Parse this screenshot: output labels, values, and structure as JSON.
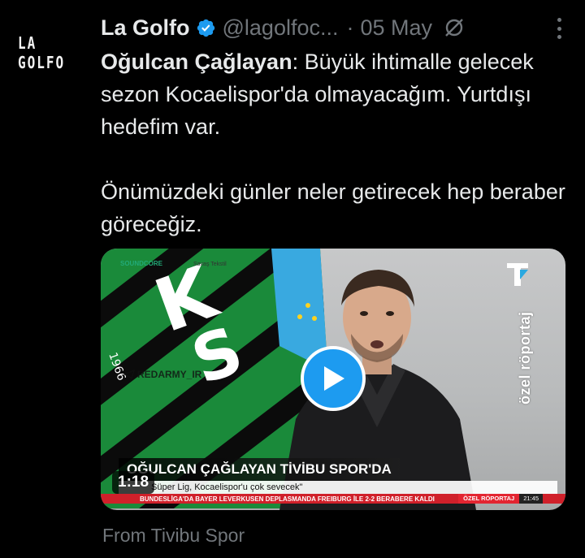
{
  "avatar": {
    "text": "LA GOLFO"
  },
  "tweet": {
    "author_name": "La Golfo",
    "handle": "@lagolfoc...",
    "separator": "·",
    "date": "05 May",
    "text_bold": "Oğulcan Çağlayan",
    "text_rest": ": Büyük ihtimalle gelecek sezon Kocaelispor'da olmayacağım. Yurtdışı hedefim var.\n\nÖnümüzdeki günler neler getirecek hep beraber göreceğiz.",
    "source": "From Tivibu Spor"
  },
  "video": {
    "duration": "1:18",
    "lower_title": "OĞULCAN ÇAĞLAYAN TİVİBU SPOR'DA",
    "lower_sub": "Süper Lig, Kocaelispor'u çok sevecek\"",
    "ticker": "BUNDESLİGA'DA BAYER LEVERKUSEN DEPLASMANDA FREIBURG İLE 2-2 BERABERE KALDI",
    "ticker_tag": "ÖZEL RÖPORTAJ",
    "ticker_time": "21:45",
    "vertical_label": "özel röportaj",
    "watermark": "REDARMY_IR",
    "sponsor": "SOUNDCORE",
    "sponsor2": "Savaş Tekstil"
  },
  "colors": {
    "accent": "#1d9bf0",
    "muted": "#71767b",
    "ticker_red": "#d0202a",
    "flag_green": "#1a8a3a"
  }
}
